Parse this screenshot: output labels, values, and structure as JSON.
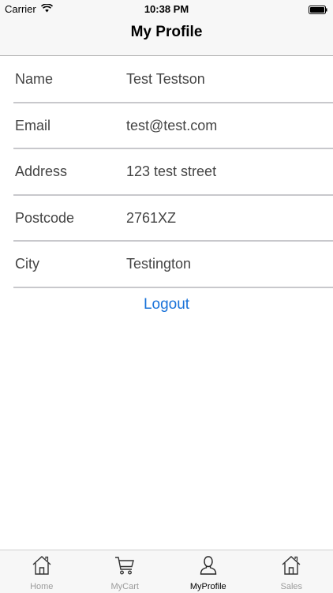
{
  "status_bar": {
    "carrier": "Carrier",
    "time": "10:38 PM",
    "wifi_icon": "wifi-icon",
    "battery_icon": "battery-icon"
  },
  "nav": {
    "title": "My Profile"
  },
  "profile": {
    "rows": [
      {
        "label": "Name",
        "value": "Test Testson"
      },
      {
        "label": "Email",
        "value": "test@test.com"
      },
      {
        "label": "Address",
        "value": "123 test street"
      },
      {
        "label": "Postcode",
        "value": "2761XZ"
      },
      {
        "label": "City",
        "value": "Testington"
      }
    ],
    "logout_label": "Logout"
  },
  "tab_bar": {
    "tabs": [
      {
        "label": "Home",
        "icon": "home-icon",
        "active": false
      },
      {
        "label": "MyCart",
        "icon": "cart-icon",
        "active": false
      },
      {
        "label": "MyProfile",
        "icon": "user-icon",
        "active": true
      },
      {
        "label": "Sales",
        "icon": "home-icon",
        "active": false
      }
    ]
  },
  "colors": {
    "accent": "#1a73d9",
    "bar_background": "#f7f7f7",
    "separator": "#c8c8cc",
    "inactive_tab": "#9b9b9b"
  }
}
